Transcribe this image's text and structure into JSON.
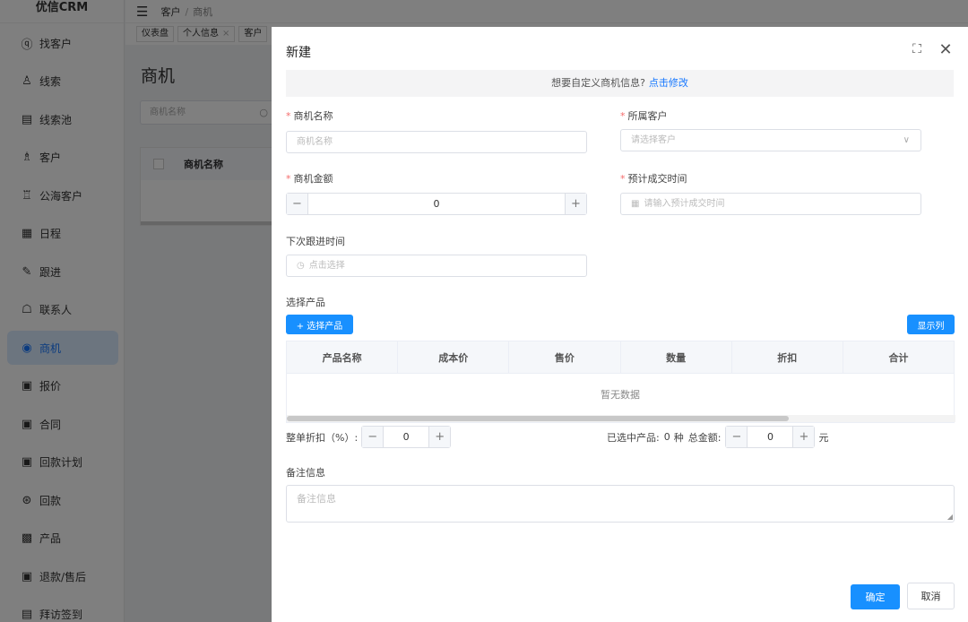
{
  "app": {
    "logo": "优信CRM"
  },
  "sidebar": {
    "items": [
      {
        "label": "找客户",
        "icon": "search-user-icon",
        "glyph": "ⓠ"
      },
      {
        "label": "线索",
        "icon": "person-icon",
        "glyph": "♙"
      },
      {
        "label": "线索池",
        "icon": "document-icon",
        "glyph": "▤"
      },
      {
        "label": "客户",
        "icon": "users-icon",
        "glyph": "♗"
      },
      {
        "label": "公海客户",
        "icon": "group-icon",
        "glyph": "♖"
      },
      {
        "label": "日程",
        "icon": "calendar-icon",
        "glyph": "▦"
      },
      {
        "label": "跟进",
        "icon": "edit-icon",
        "glyph": "✎"
      },
      {
        "label": "联系人",
        "icon": "contact-icon",
        "glyph": "☖"
      },
      {
        "label": "商机",
        "icon": "opportunity-icon",
        "glyph": "◉"
      },
      {
        "label": "报价",
        "icon": "quote-icon",
        "glyph": "▣"
      },
      {
        "label": "合同",
        "icon": "contract-icon",
        "glyph": "▣"
      },
      {
        "label": "回款计划",
        "icon": "plan-icon",
        "glyph": "▣"
      },
      {
        "label": "回款",
        "icon": "payment-icon",
        "glyph": "⊛"
      },
      {
        "label": "产品",
        "icon": "product-icon",
        "glyph": "▩"
      },
      {
        "label": "退款/售后",
        "icon": "refund-icon",
        "glyph": "▣"
      },
      {
        "label": "拜访签到",
        "icon": "checkin-icon",
        "glyph": "▤"
      }
    ],
    "active_index": 8
  },
  "topbar": {
    "breadcrumb": [
      "客户",
      "商机"
    ]
  },
  "tags": [
    "仪表盘",
    "个人信息",
    "客户"
  ],
  "page": {
    "title": "商机",
    "search_placeholder": "商机名称",
    "table_header": "商机名称"
  },
  "drawer": {
    "title": "新建",
    "notice_text": "想要自定义商机信息?",
    "notice_link": "点击修改",
    "fields": {
      "name_label": "商机名称",
      "name_placeholder": "商机名称",
      "customer_label": "所属客户",
      "customer_placeholder": "请选择客户",
      "amount_label": "商机金额",
      "amount_value": "0",
      "deal_time_label": "预计成交时间",
      "deal_time_placeholder": "请输入预计成交时间",
      "next_follow_label": "下次跟进时间",
      "next_follow_placeholder": "点击选择"
    },
    "products": {
      "section_label": "选择产品",
      "select_button": "+ 选择产品",
      "columns_button": "显示列",
      "columns": [
        "产品名称",
        "成本价",
        "售价",
        "数量",
        "折扣",
        "合计"
      ],
      "empty_text": "暂无数据"
    },
    "discount": {
      "label": "整单折扣（%）:",
      "value": "0"
    },
    "summary": {
      "selected_label": "已选中产品:",
      "count": "0",
      "count_unit": "种",
      "total_label": "总金额:",
      "total_value": "0",
      "currency": "元"
    },
    "remark": {
      "label": "备注信息",
      "placeholder": "备注信息"
    },
    "footer": {
      "confirm": "确定",
      "cancel": "取消"
    }
  }
}
